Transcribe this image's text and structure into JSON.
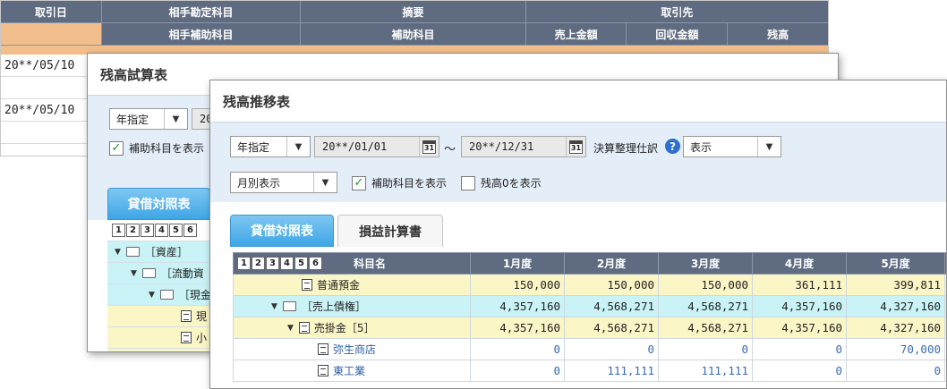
{
  "ledger": {
    "headers_row1": [
      "取引日",
      "相手勘定科目",
      "摘要",
      "取引先"
    ],
    "headers_row2": [
      "",
      "相手補助科目",
      "補助科目",
      "売上金額",
      "回収金額",
      "残高"
    ],
    "dates": [
      "20**/05/10",
      "20**/05/10"
    ]
  },
  "trial_balance_window": {
    "title": "残高試算表",
    "period_select": "年指定",
    "date_partial": "20",
    "show_sub_checkbox": "補助科目を表示",
    "tab_bs": "貸借対照表",
    "level_buttons": [
      "1",
      "2",
      "3",
      "4",
      "5",
      "6"
    ],
    "tree": [
      {
        "label": "［資産］"
      },
      {
        "label": "［流動資"
      },
      {
        "label": "［現金"
      },
      {
        "label": "現"
      },
      {
        "label": "小"
      }
    ]
  },
  "transition_window": {
    "title": "残高推移表",
    "period_select": "年指定",
    "date_from": "20**/01/01",
    "tilde": "～",
    "date_to": "20**/12/31",
    "adjust_label": "決算整理仕訳",
    "adjust_select": "表示",
    "display_select": "月別表示",
    "show_sub_checkbox": "補助科目を表示",
    "show_zero_checkbox": "残高0を表示",
    "tabs": [
      "貸借対照表",
      "損益計算書"
    ],
    "level_buttons": [
      "1",
      "2",
      "3",
      "4",
      "5",
      "6"
    ],
    "grid": {
      "name_header": "科目名",
      "month_headers": [
        "1月度",
        "2月度",
        "3月度",
        "4月度",
        "5月度"
      ],
      "rows": [
        {
          "name": "普通預金",
          "values": [
            "150,000",
            "150,000",
            "150,000",
            "361,111",
            "399,811"
          ]
        },
        {
          "name": "［売上債権］",
          "values": [
            "4,357,160",
            "4,568,271",
            "4,568,271",
            "4,357,160",
            "4,327,160"
          ]
        },
        {
          "name": "売掛金［5］",
          "values": [
            "4,357,160",
            "4,568,271",
            "4,568,271",
            "4,357,160",
            "4,327,160"
          ]
        },
        {
          "name": "弥生商店",
          "values": [
            "0",
            "0",
            "0",
            "0",
            "70,000"
          ]
        },
        {
          "name": "東工業",
          "values": [
            "0",
            "111,111",
            "111,111",
            "0",
            "0"
          ]
        }
      ]
    }
  }
}
